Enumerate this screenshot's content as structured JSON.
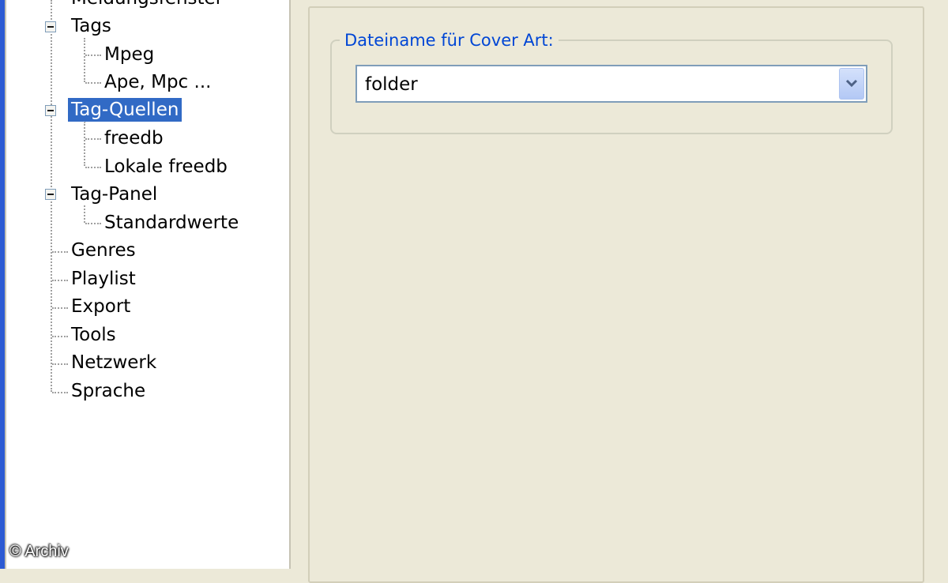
{
  "tree": {
    "items": [
      {
        "label": "Meldungsfenster"
      },
      {
        "label": "Tags"
      },
      {
        "label": "Mpeg"
      },
      {
        "label": "Ape, Mpc ..."
      },
      {
        "label": "Tag-Quellen",
        "selected": true
      },
      {
        "label": "freedb"
      },
      {
        "label": "Lokale freedb"
      },
      {
        "label": "Tag-Panel"
      },
      {
        "label": "Standardwerte"
      },
      {
        "label": "Genres"
      },
      {
        "label": "Playlist"
      },
      {
        "label": "Export"
      },
      {
        "label": "Tools"
      },
      {
        "label": "Netzwerk"
      },
      {
        "label": "Sprache"
      }
    ]
  },
  "settings": {
    "group_label": "Dateiname für Cover Art:",
    "cover_art_filename": "folder"
  },
  "icons": {
    "expander": "minus-box-icon",
    "dropdown": "chevron-down-icon"
  },
  "colors": {
    "selection": "#316ac5",
    "group_label": "#0046d5",
    "dialog_background": "#ece9d8"
  },
  "watermark": "© Archiv"
}
